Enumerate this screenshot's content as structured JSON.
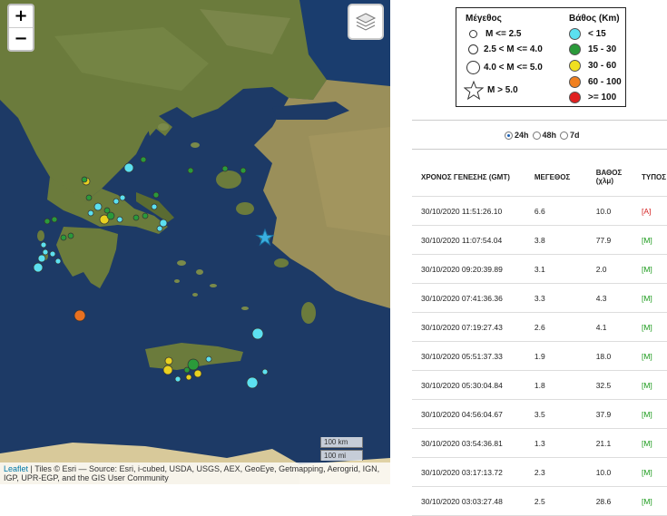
{
  "map": {
    "zoom_in": "+",
    "zoom_out": "−",
    "scale_km": "100 km",
    "scale_mi": "100 mi",
    "attribution_link": "Leaflet",
    "attribution_text": " | Tiles © Esri — Source: Esri, i-cubed, USDA, USGS, AEX, GeoEye, Getmapping, Aerogrid, IGN, IGP, UPR-EGP, and the GIS User Community",
    "colors": {
      "sea": "#1d3a66",
      "land": "#6b7b3c",
      "marker_lt15": "#5ce0f0",
      "marker_15_30": "#2a9a3a",
      "marker_30_60": "#e8d020",
      "marker_60_100": "#e87020",
      "star": "#3ab0e0"
    }
  },
  "legend": {
    "mag_title": "Μέγεθος",
    "depth_title": "Βάθος (Km)",
    "mag_items": [
      "M <= 2.5",
      "2.5 < M <= 4.0",
      "4.0 < M <= 5.0",
      "M > 5.0"
    ],
    "depth_items": [
      {
        "label": "< 15",
        "color": "#5ce0f0"
      },
      {
        "label": "15 - 30",
        "color": "#2a9a3a"
      },
      {
        "label": "30 - 60",
        "color": "#f0e020"
      },
      {
        "label": "60 - 100",
        "color": "#f08020"
      },
      {
        "label": ">= 100",
        "color": "#e02020"
      }
    ]
  },
  "filters": {
    "options": [
      "24h",
      "48h",
      "7d"
    ],
    "selected": "24h"
  },
  "table": {
    "headers": [
      "ΧΡΟΝΟΣ ΓΕΝΕΣΗΣ (GMT)",
      "ΜΕΓΕΘΟΣ",
      "ΒΑΘΟΣ (χλμ)",
      "ΤΥΠΟΣ"
    ],
    "rows": [
      {
        "time": "30/10/2020 11:51:26.10",
        "mag": "6.6",
        "depth": "10.0",
        "type": "[A]"
      },
      {
        "time": "30/10/2020 11:07:54.04",
        "mag": "3.8",
        "depth": "77.9",
        "type": "[M]"
      },
      {
        "time": "30/10/2020 09:20:39.89",
        "mag": "3.1",
        "depth": "2.0",
        "type": "[M]"
      },
      {
        "time": "30/10/2020 07:41:36.36",
        "mag": "3.3",
        "depth": "4.3",
        "type": "[M]"
      },
      {
        "time": "30/10/2020 07:19:27.43",
        "mag": "2.6",
        "depth": "4.1",
        "type": "[M]"
      },
      {
        "time": "30/10/2020 05:51:37.33",
        "mag": "1.9",
        "depth": "18.0",
        "type": "[M]"
      },
      {
        "time": "30/10/2020 05:30:04.84",
        "mag": "1.8",
        "depth": "32.5",
        "type": "[M]"
      },
      {
        "time": "30/10/2020 04:56:04.67",
        "mag": "3.5",
        "depth": "37.9",
        "type": "[M]"
      },
      {
        "time": "30/10/2020 03:54:36.81",
        "mag": "1.3",
        "depth": "21.1",
        "type": "[M]"
      },
      {
        "time": "30/10/2020 03:17:13.72",
        "mag": "2.3",
        "depth": "10.0",
        "type": "[M]"
      },
      {
        "time": "30/10/2020 03:03:27.48",
        "mag": "2.5",
        "depth": "28.6",
        "type": "[M]"
      }
    ],
    "type_colors": {
      "[A]": "#d42020",
      "[M]": "#1a9a1a"
    }
  }
}
